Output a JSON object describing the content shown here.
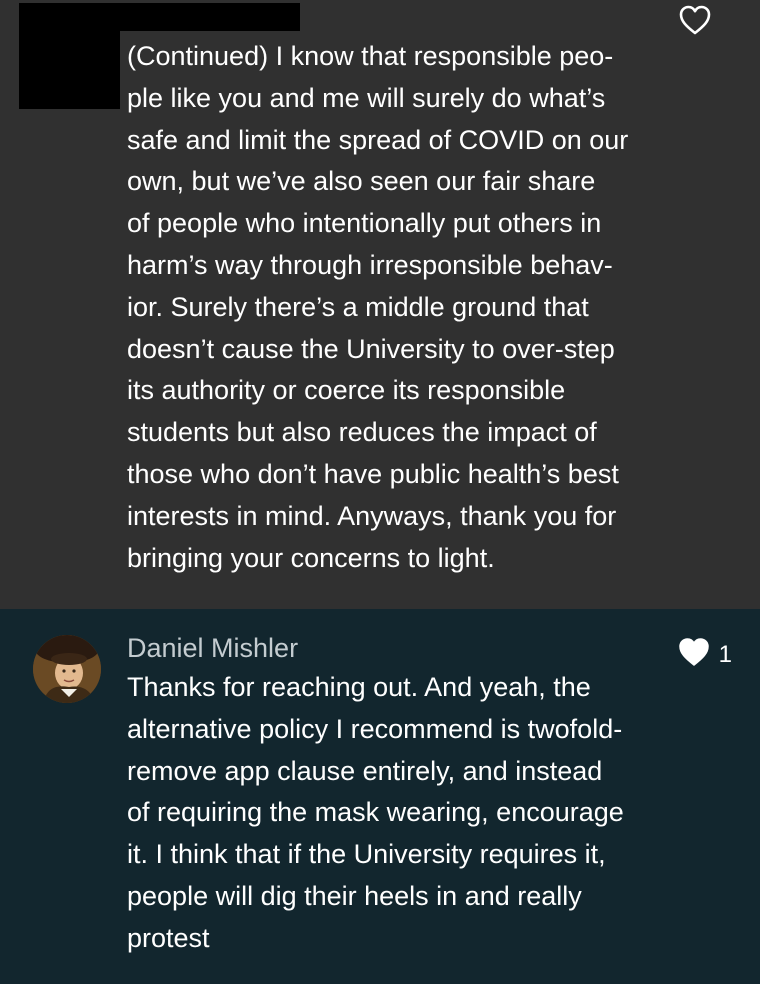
{
  "comments": [
    {
      "author": "",
      "redacted": true,
      "liked": false,
      "like_count": "",
      "body_lines": [
        "(Continued) I know that responsible peo-",
        "ple like you and me will surely do what’s",
        "safe and limit the spread of COVID on our",
        "own, but we’ve also seen our fair share",
        "of people who intentionally put others in",
        "harm’s way through irresponsible behav-",
        "ior. Surely there’s a middle ground that",
        "doesn’t cause the University to over-step",
        "its authority or coerce its responsible",
        "students but also reduces the impact of",
        "those who don’t have public health’s best",
        "interests in mind. Anyways, thank you for",
        "bringing your concerns to light."
      ]
    },
    {
      "author": "Daniel Mishler",
      "redacted": false,
      "liked": true,
      "like_count": "1",
      "body_lines": [
        "Thanks for reaching out. And yeah, the",
        "alternative policy I recommend is twofold-",
        "remove app clause entirely, and instead",
        "of requiring the mask wearing, encourage",
        "it. I think that if the University requires it,",
        "people will dig their heels in and really",
        "protest"
      ]
    }
  ],
  "icons": {
    "like_outline": "heart-outline-icon",
    "like_filled": "heart-filled-icon"
  },
  "colors": {
    "comment_bg_1": "#303030",
    "comment_bg_2": "#12262e",
    "text": "#ffffff",
    "author_text": "#c4ccd0"
  }
}
